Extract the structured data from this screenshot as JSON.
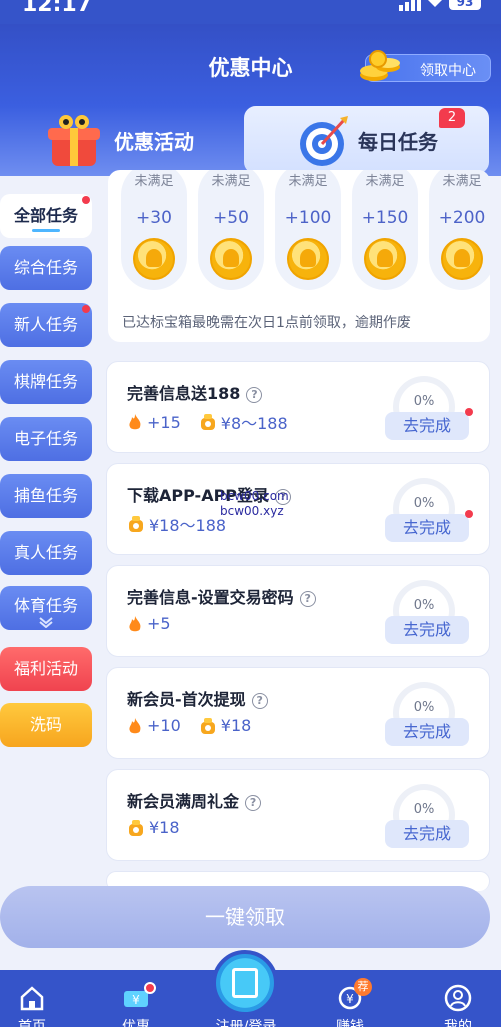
{
  "status": {
    "time": "12:17",
    "battery": "93"
  },
  "header": {
    "title": "优惠中心",
    "claim_center": "领取中心"
  },
  "tabs": {
    "promotions": "优惠活动",
    "daily_tasks": "每日任务",
    "daily_badge": "2"
  },
  "sidebar": {
    "items": [
      {
        "label": "全部任务"
      },
      {
        "label": "综合任务"
      },
      {
        "label": "新人任务"
      },
      {
        "label": "棋牌任务"
      },
      {
        "label": "电子任务"
      },
      {
        "label": "捕鱼任务"
      },
      {
        "label": "真人任务"
      },
      {
        "label": "体育任务"
      },
      {
        "label": "福利活动"
      },
      {
        "label": "洗码"
      }
    ]
  },
  "rewards": {
    "items": [
      {
        "caption": "未满足",
        "points": "+30"
      },
      {
        "caption": "未满足",
        "points": "+50"
      },
      {
        "caption": "未满足",
        "points": "+100"
      },
      {
        "caption": "未满足",
        "points": "+150"
      },
      {
        "caption": "未满足",
        "points": "+200"
      }
    ],
    "note": "已达标宝箱最晚需在次日1点前领取，逾期作废"
  },
  "tasks": [
    {
      "name": "完善信息送188",
      "fire": "+15",
      "bag": "¥8～188",
      "progress": "0%",
      "button": "去完成"
    },
    {
      "name": "下载APP-APP登录",
      "bag": "¥18～188",
      "progress": "0%",
      "button": "去完成"
    },
    {
      "name": "完善信息-设置交易密码",
      "fire": "+5",
      "progress": "0%",
      "button": "去完成"
    },
    {
      "name": "新会员-首次提现",
      "fire": "+10",
      "bag": "¥18",
      "progress": "0%",
      "button": "去完成"
    },
    {
      "name": "新会员满周礼金",
      "bag": "¥18",
      "progress": "0%",
      "button": "去完成"
    }
  ],
  "watermark": {
    "line1": "bcw00.com",
    "line2": "bcw00.xyz"
  },
  "claim_all": "一键领取",
  "nav": {
    "home": "首页",
    "promo": "优惠",
    "register": "注册/登录",
    "earn": "赚钱",
    "earn_badge": "荐",
    "mine": "我的"
  }
}
